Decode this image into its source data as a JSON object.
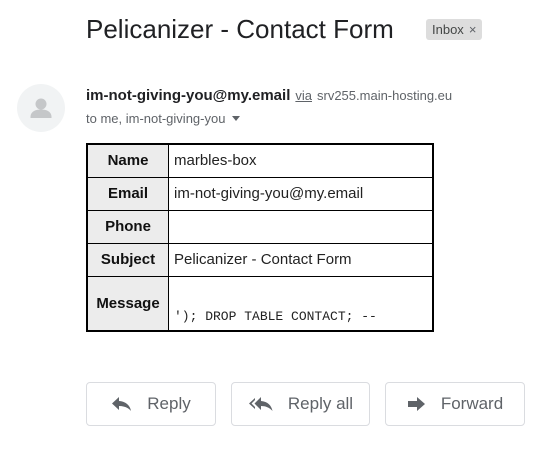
{
  "email": {
    "subject": "Pelicanizer - Contact Form",
    "label_badge": "Inbox",
    "badge_close": "×",
    "sender_email": "im-not-giving-you@my.email",
    "via_text": "via",
    "via_host": "srv255.main-hosting.eu",
    "recipients": "to me, im-not-giving-you"
  },
  "form": {
    "rows": [
      {
        "label": "Name",
        "value": "marbles-box"
      },
      {
        "label": "Email",
        "value": "im-not-giving-you@my.email"
      },
      {
        "label": "Phone",
        "value": ""
      },
      {
        "label": "Subject",
        "value": "Pelicanizer - Contact Form"
      },
      {
        "label": "Message",
        "value": "'); DROP TABLE CONTACT; --"
      }
    ]
  },
  "actions": {
    "reply": "Reply",
    "reply_all": "Reply all",
    "forward": "Forward"
  },
  "icons": {
    "avatar": "person-icon",
    "reply": "reply-icon",
    "reply_all": "reply-all-icon",
    "forward": "forward-icon",
    "caret": "chevron-down-icon",
    "badge_close": "close-icon"
  }
}
